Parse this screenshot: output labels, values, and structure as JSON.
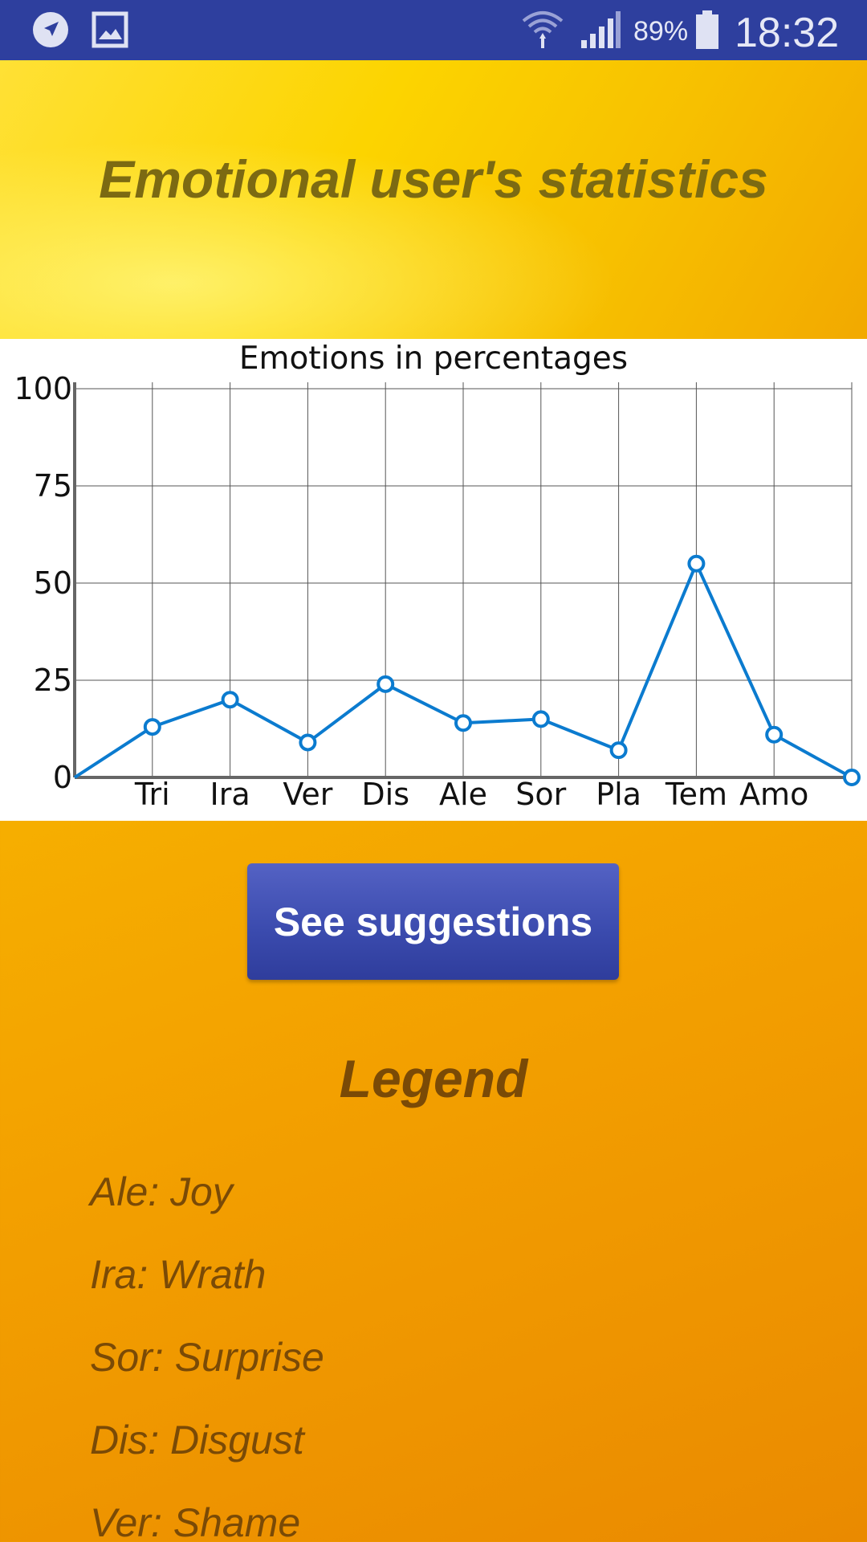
{
  "status_bar": {
    "battery": "89%",
    "time": "18:32",
    "icons": [
      "navigation-icon",
      "image-icon",
      "wifi-icon",
      "signal-icon",
      "battery-icon"
    ]
  },
  "header": {
    "title": "Emotional user's statistics"
  },
  "chart_data": {
    "type": "line",
    "title": "Emotions in percentages",
    "categories": [
      "",
      "Tri",
      "Ira",
      "Ver",
      "Dis",
      "Ale",
      "Sor",
      "Pla",
      "Tem",
      "Amo",
      ""
    ],
    "values": [
      0,
      13,
      20,
      9,
      24,
      14,
      15,
      7,
      55,
      11,
      0
    ],
    "ylim": [
      0,
      100
    ],
    "yticks": [
      0,
      25,
      50,
      75,
      100
    ],
    "grid": true,
    "line_color": "#0b7bcf"
  },
  "actions": {
    "suggestions_label": "See suggestions"
  },
  "legend": {
    "title": "Legend",
    "items": [
      "Ale: Joy",
      "Ira: Wrath",
      "Sor: Surprise",
      "Dis: Disgust",
      "Ver: Shame"
    ]
  }
}
